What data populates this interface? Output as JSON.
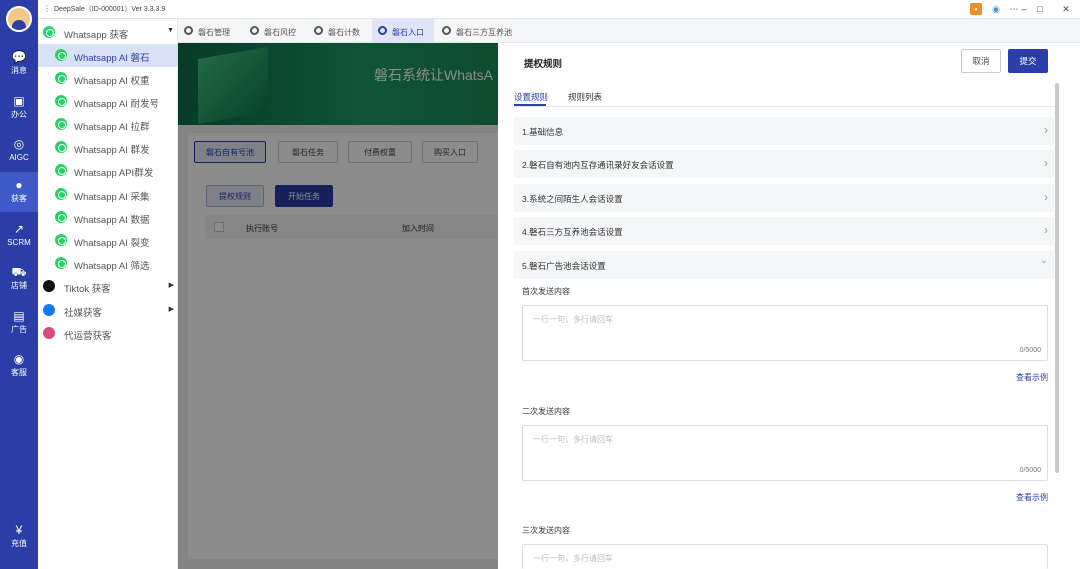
{
  "app": {
    "title": "DeepSale（ID-000001）Ver 3.3.3.9"
  },
  "rail": [
    {
      "label": "消息",
      "icon": "chat-icon"
    },
    {
      "label": "办公",
      "icon": "briefcase-icon"
    },
    {
      "label": "AIGC",
      "icon": "aigc-icon"
    },
    {
      "label": "获客",
      "icon": "users-icon"
    },
    {
      "label": "SCRM",
      "icon": "chart-icon"
    },
    {
      "label": "店铺",
      "icon": "cart-icon"
    },
    {
      "label": "广告",
      "icon": "ads-icon"
    },
    {
      "label": "客服",
      "icon": "headset-icon"
    },
    {
      "label": "充值",
      "icon": "coin-icon"
    }
  ],
  "nav": {
    "whatsapp_group": "Whatsapp 获客",
    "items": [
      "Whatsapp AI 磐石",
      "Whatsapp AI 权重",
      "Whatsapp AI 耐发号",
      "Whatsapp AI 拉群",
      "Whatsapp AI 群发",
      "Whatsapp API群发",
      "Whatsapp AI 采集",
      "Whatsapp AI 数据",
      "Whatsapp AI 裂变",
      "Whatsapp AI 筛选"
    ],
    "tiktok": "Tiktok 获客",
    "social": "社媒获客",
    "agency": "代运营获客"
  },
  "tabs": [
    "磐石管理",
    "磐石风控",
    "磐石计数",
    "磐石入口",
    "磐石三方互养池"
  ],
  "background": {
    "banner_title": "磐石系统让WhatsA",
    "buttons": [
      "磐石自有号池",
      "磐石任务",
      "付费权重",
      "购买入口"
    ],
    "action_buttons": [
      "提权规则",
      "开始任务"
    ],
    "columns": [
      "执行账号",
      "加入时间"
    ]
  },
  "drawer": {
    "title": "提权规则",
    "cancel": "取消",
    "submit": "提交",
    "subtabs": [
      "设置规则",
      "规则列表"
    ],
    "sections": [
      "1.基础信息",
      "2.磐石自有池内互存通讯录好友会话设置",
      "3.系统之间陌生人会话设置",
      "4.磐石三方互养池会话设置",
      "5.磐石广告池会话设置"
    ],
    "fields": [
      {
        "label": "首次发送内容",
        "placeholder": "一行一句，多行请回车",
        "count": "0/5000",
        "example": "查看示例"
      },
      {
        "label": "二次发送内容",
        "placeholder": "一行一句，多行请回车",
        "count": "0/5000",
        "example": "查看示例"
      },
      {
        "label": "三次发送内容",
        "placeholder": "一行一句，多行请回车"
      }
    ]
  }
}
